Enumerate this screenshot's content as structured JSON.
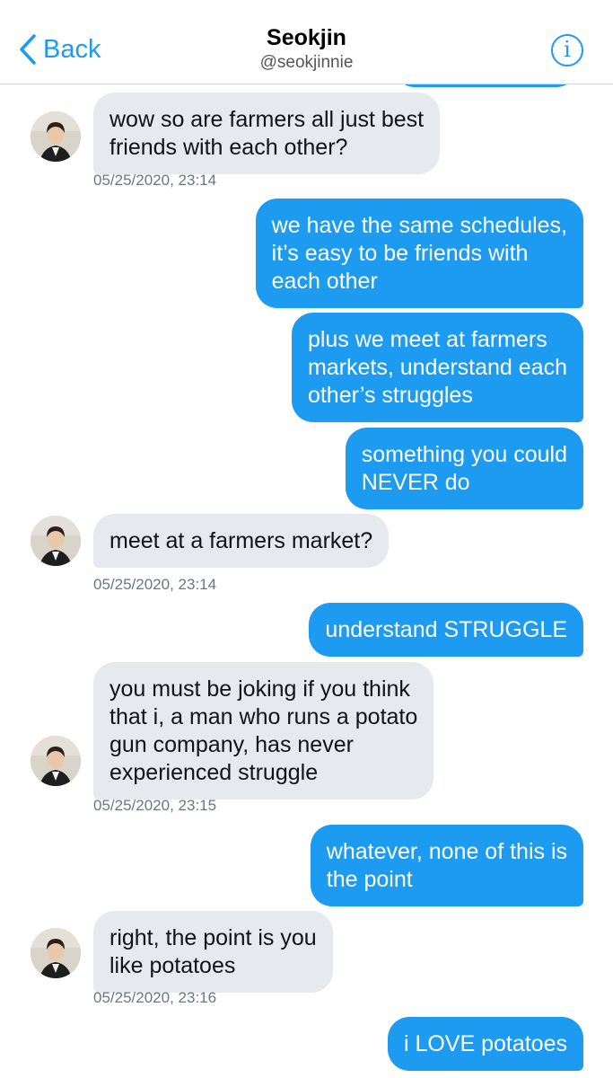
{
  "header": {
    "back_label": "Back",
    "title": "Seokjin",
    "handle": "@seokjinnie",
    "info_icon": "i"
  },
  "colors": {
    "accent": "#1d9bf0",
    "incoming_bubble": "#e6e9ee",
    "timestamp": "#657786"
  },
  "messages": [
    {
      "from": "contact",
      "lines": [
        "wow so are farmers all just best",
        "friends with each other?"
      ]
    },
    {
      "from": "me",
      "lines": [
        "we have the same schedules,",
        "it’s easy to be friends with",
        "each other"
      ]
    },
    {
      "from": "me",
      "lines": [
        "plus we meet at farmers",
        "markets, understand each",
        "other’s struggles"
      ]
    },
    {
      "from": "me",
      "lines": [
        "something you could",
        "NEVER do"
      ]
    },
    {
      "from": "contact",
      "lines": [
        "meet at a farmers market?"
      ]
    },
    {
      "from": "me",
      "lines": [
        "understand STRUGGLE"
      ]
    },
    {
      "from": "contact",
      "lines": [
        "you must be joking if you think",
        "that i, a man who runs a potato",
        "gun company, has never",
        "experienced struggle"
      ]
    },
    {
      "from": "me",
      "lines": [
        "whatever, none of this is",
        "the point"
      ]
    },
    {
      "from": "contact",
      "lines": [
        "right, the point is you",
        "like potatoes"
      ]
    },
    {
      "from": "me",
      "lines": [
        "i LOVE potatoes"
      ]
    }
  ],
  "timestamps": [
    "05/25/2020, 23:14",
    "05/25/2020, 23:14",
    "05/25/2020, 23:15",
    "05/25/2020, 23:16"
  ]
}
